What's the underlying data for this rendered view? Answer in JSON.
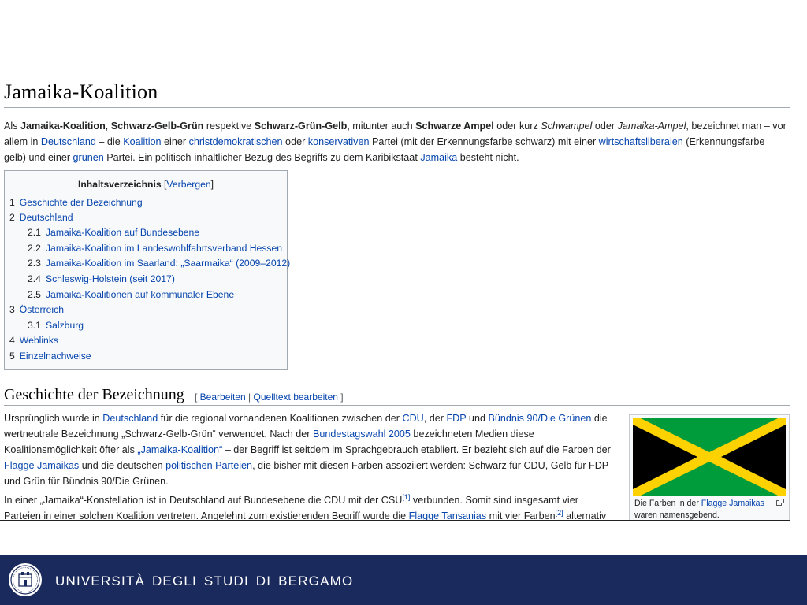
{
  "article": {
    "title": "Jamaika-Koalition",
    "intro": [
      {
        "t": "Als "
      },
      {
        "b": "Jamaika-Koalition"
      },
      {
        "t": ", "
      },
      {
        "b": "Schwarz-Gelb-Grün"
      },
      {
        "t": " respektive "
      },
      {
        "b": "Schwarz-Grün-Gelb"
      },
      {
        "t": ", mitunter auch "
      },
      {
        "b": "Schwarze Ampel"
      },
      {
        "t": " oder kurz "
      },
      {
        "i": "Schwampel"
      },
      {
        "t": " oder "
      },
      {
        "i": "Jamaika-Ampel"
      },
      {
        "t": ", bezeichnet man – vor allem in "
      },
      {
        "a": "Deutschland"
      },
      {
        "t": " – die "
      },
      {
        "a": "Koalition"
      },
      {
        "t": " einer "
      },
      {
        "a": "christdemokratischen"
      },
      {
        "t": " oder "
      },
      {
        "a": "konservativen"
      },
      {
        "t": " Partei (mit der Erkennungsfarbe schwarz) mit einer "
      },
      {
        "a": "wirtschaftsliberalen"
      },
      {
        "t": " (Erkennungsfarbe gelb) und einer "
      },
      {
        "a": "grünen"
      },
      {
        "t": " Partei. Ein politisch-inhaltlicher Bezug des Begriffs zu dem Karibikstaat "
      },
      {
        "a": "Jamaika"
      },
      {
        "t": " besteht nicht."
      }
    ]
  },
  "toc": {
    "title": "Inhaltsverzeichnis",
    "bracket_open": " [",
    "toggle": "Verbergen",
    "bracket_close": "]",
    "items": [
      {
        "num": "1",
        "label": "Geschichte der Bezeichnung"
      },
      {
        "num": "2",
        "label": "Deutschland"
      },
      {
        "num": "2.1",
        "label": "Jamaika-Koalition auf Bundesebene"
      },
      {
        "num": "2.2",
        "label": "Jamaika-Koalition im Landeswohlfahrtsverband Hessen"
      },
      {
        "num": "2.3",
        "label": "Jamaika-Koalition im Saarland: „Saarmaika“ (2009–2012)"
      },
      {
        "num": "2.4",
        "label": "Schleswig-Holstein (seit 2017)"
      },
      {
        "num": "2.5",
        "label": "Jamaika-Koalitionen auf kommunaler Ebene"
      },
      {
        "num": "3",
        "label": "Österreich"
      },
      {
        "num": "3.1",
        "label": "Salzburg"
      },
      {
        "num": "4",
        "label": "Weblinks"
      },
      {
        "num": "5",
        "label": "Einzelnachweise"
      }
    ]
  },
  "section": {
    "title": "Geschichte der Bezeichnung",
    "bracket_open": "[ ",
    "edit": "Bearbeiten",
    "separator": " | ",
    "edit_source": "Quelltext bearbeiten",
    "bracket_close": " ]"
  },
  "paragraphs": [
    [
      {
        "t": "Ursprünglich wurde in "
      },
      {
        "a": "Deutschland"
      },
      {
        "t": " für die regional vorhandenen Koalitionen zwischen der "
      },
      {
        "a": "CDU"
      },
      {
        "t": ", der "
      },
      {
        "a": "FDP"
      },
      {
        "t": " und "
      },
      {
        "a": "Bündnis 90/Die Grünen"
      },
      {
        "t": " die wertneutrale Bezeichnung „Schwarz-Gelb-Grün“ verwendet. Nach der "
      },
      {
        "a": "Bundestagswahl 2005"
      },
      {
        "t": " bezeichneten Medien diese Koalitionsmöglichkeit öfter als "
      },
      {
        "a": "„Jamaika-Koalition“"
      },
      {
        "t": " – der Begriff ist seitdem im Sprachgebrauch etabliert. Er bezieht sich auf die Farben der "
      },
      {
        "a": "Flagge Jamaikas"
      },
      {
        "t": " und die deutschen "
      },
      {
        "a": "politischen Parteien"
      },
      {
        "t": ", die bisher mit diesen Farben assoziiert werden: Schwarz für CDU, Gelb für FDP und Grün für Bündnis 90/Die Grünen."
      }
    ],
    [
      {
        "t": "In einer „Jamaika“-Konstellation ist in Deutschland auf Bundesebene die CDU mit der CSU"
      },
      {
        "sup": "[1]"
      },
      {
        "t": " verbunden. Somit sind insgesamt vier Parteien in einer solchen Koalition vertreten. Angelehnt zum existierenden Begriff wurde die "
      },
      {
        "a": "Flagge Tansanias"
      },
      {
        "t": " mit vier Farben"
      },
      {
        "sup": "[2]"
      },
      {
        "t": " alternativ zu"
      }
    ]
  ],
  "figure": {
    "caption_pre": "Die Farben in der ",
    "caption_link": "Flagge Jamaikas",
    "caption_post": " waren namensgebend.",
    "colors": {
      "black": "#000000",
      "yellow": "#fed100",
      "green": "#009b3a"
    }
  },
  "footer": {
    "university": "UNIVERSITÀ DEGLI STUDI DI BERGAMO",
    "background": "#1b2a5c"
  }
}
